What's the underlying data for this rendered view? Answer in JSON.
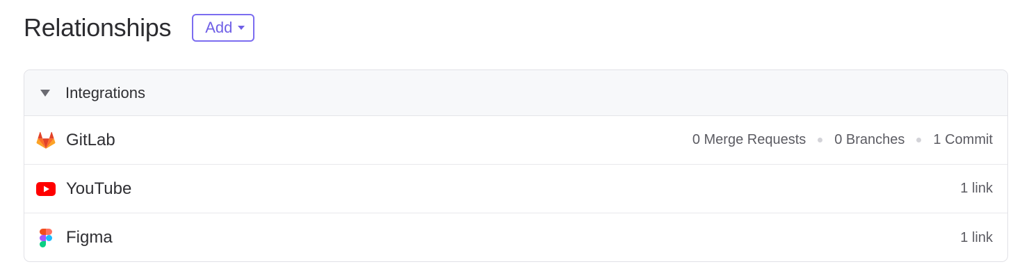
{
  "header": {
    "title": "Relationships",
    "add_label": "Add"
  },
  "panel": {
    "title": "Integrations",
    "rows": [
      {
        "icon": "gitlab-icon",
        "label": "GitLab",
        "meta": [
          "0 Merge Requests",
          "0 Branches",
          "1 Commit"
        ]
      },
      {
        "icon": "youtube-icon",
        "label": "YouTube",
        "meta": [
          "1 link"
        ]
      },
      {
        "icon": "figma-icon",
        "label": "Figma",
        "meta": [
          "1 link"
        ]
      }
    ]
  },
  "colors": {
    "accent": "#7b6cf0",
    "youtube": "#ff0000",
    "gitlab": "#fc6d26"
  }
}
